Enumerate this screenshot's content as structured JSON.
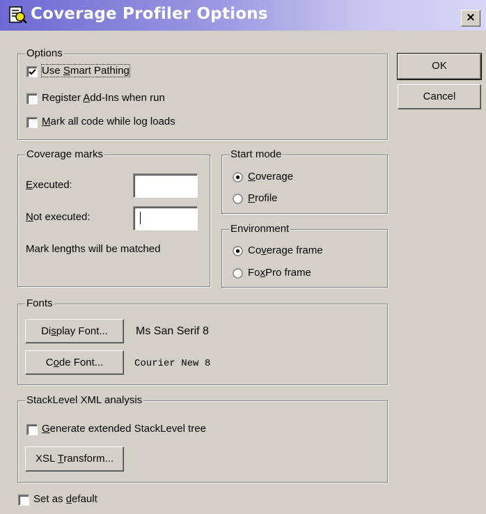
{
  "window": {
    "title": "Coverage Profiler Options",
    "close_glyph": "×",
    "title_gradient": [
      "#6d6ad3",
      "#d8d5f6"
    ]
  },
  "buttons": {
    "ok": "OK",
    "cancel": "Cancel"
  },
  "options": {
    "legend": "Options",
    "use_smart_pathing": {
      "pre": "Use ",
      "key": "S",
      "post": "mart Pathing",
      "checked": true
    },
    "register_addins": {
      "pre": "Register ",
      "key": "A",
      "post": "dd-Ins when run",
      "checked": false
    },
    "mark_all_code": {
      "pre": "",
      "key": "M",
      "post": "ark all code while log loads",
      "checked": false
    }
  },
  "coverage_marks": {
    "legend": "Coverage marks",
    "executed": {
      "pre": "",
      "key": "E",
      "post": "xecuted:",
      "value": ""
    },
    "not_executed": {
      "pre": "",
      "key": "N",
      "post": "ot executed:",
      "value": ""
    },
    "note": "Mark lengths will be matched"
  },
  "start_mode": {
    "legend": "Start mode",
    "coverage": {
      "pre": "",
      "key": "C",
      "post": "overage",
      "selected": true
    },
    "profile": {
      "pre": "",
      "key": "P",
      "post": "rofile",
      "selected": false
    }
  },
  "environment": {
    "legend": "Environment",
    "coverage_frame": {
      "pre": "Co",
      "key": "v",
      "post": "erage frame",
      "selected": true
    },
    "foxpro_frame": {
      "pre": "Fo",
      "key": "x",
      "post": "Pro frame",
      "selected": false
    }
  },
  "fonts": {
    "legend": "Fonts",
    "display_button": {
      "pre": "Di",
      "key": "s",
      "post": "play Font..."
    },
    "display_value": "Ms San Serif 8",
    "code_button": {
      "pre": "C",
      "key": "o",
      "post": "de Font..."
    },
    "code_value": "Courier New 8"
  },
  "stacklevel": {
    "legend": "StackLevel XML analysis",
    "generate_tree": {
      "pre": "",
      "key": "G",
      "post": "enerate extended StackLevel tree",
      "checked": false
    },
    "xsl_button": {
      "pre": "XSL ",
      "key": "T",
      "post": "ransform..."
    }
  },
  "footer": {
    "set_default": {
      "pre": "Set as ",
      "key": "d",
      "post": "efault",
      "checked": false
    }
  },
  "icons": [
    "app-icon",
    "close-icon",
    "checkmark-icon",
    "radio-dot-icon"
  ]
}
